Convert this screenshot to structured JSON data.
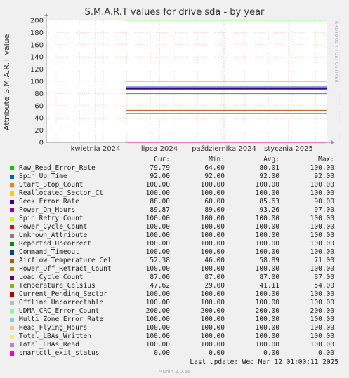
{
  "chart_data": {
    "type": "line",
    "title": "S.M.A.R.T values for drive sda - by year",
    "ylabel": "Attribute S.M.A.R.T value",
    "ylim": [
      0,
      200
    ],
    "yticks": [
      0,
      20,
      40,
      60,
      80,
      100,
      120,
      140,
      160,
      180,
      200
    ],
    "xticks": [
      "kwietnia 2024",
      "lipca 2024",
      "października 2024",
      "stycznia 2025"
    ],
    "grid": true,
    "legend_position": "bottom",
    "columns": [
      "Cur:",
      "Min:",
      "Avg:",
      "Max:"
    ],
    "series": [
      {
        "name": "Raw_Read_Error_Rate",
        "color": "#00cc00",
        "cur": "79.79",
        "min": "64.00",
        "avg": "80.01",
        "max": "100.00"
      },
      {
        "name": "Spin_Up_Time",
        "color": "#0066b3",
        "cur": "92.00",
        "min": "92.00",
        "avg": "92.00",
        "max": "92.00"
      },
      {
        "name": "Start_Stop_Count",
        "color": "#ff8000",
        "cur": "100.00",
        "min": "100.00",
        "avg": "100.00",
        "max": "100.00"
      },
      {
        "name": "Reallocated_Sector_Ct",
        "color": "#ffcc00",
        "cur": "100.00",
        "min": "100.00",
        "avg": "100.00",
        "max": "100.00"
      },
      {
        "name": "Seek_Error_Rate",
        "color": "#330099",
        "cur": "88.00",
        "min": "60.00",
        "avg": "85.63",
        "max": "90.00"
      },
      {
        "name": "Power_On_Hours",
        "color": "#990099",
        "cur": "89.87",
        "min": "89.00",
        "avg": "93.26",
        "max": "97.00"
      },
      {
        "name": "Spin_Retry_Count",
        "color": "#ccff00",
        "cur": "100.00",
        "min": "100.00",
        "avg": "100.00",
        "max": "100.00"
      },
      {
        "name": "Power_Cycle_Count",
        "color": "#ff0000",
        "cur": "100.00",
        "min": "100.00",
        "avg": "100.00",
        "max": "100.00"
      },
      {
        "name": "Unknown_Attribute",
        "color": "#808080",
        "cur": "100.00",
        "min": "100.00",
        "avg": "100.00",
        "max": "100.00"
      },
      {
        "name": "Reported_Uncorrect",
        "color": "#008f00",
        "cur": "100.00",
        "min": "100.00",
        "avg": "100.00",
        "max": "100.00"
      },
      {
        "name": "Command_Timeout",
        "color": "#00487d",
        "cur": "100.00",
        "min": "100.00",
        "avg": "100.00",
        "max": "100.00"
      },
      {
        "name": "Airflow_Temperature_Cel",
        "color": "#b35a00",
        "cur": "52.38",
        "min": "46.00",
        "avg": "58.89",
        "max": "71.00"
      },
      {
        "name": "Power_Off_Retract_Count",
        "color": "#b38f00",
        "cur": "100.00",
        "min": "100.00",
        "avg": "100.00",
        "max": "100.00"
      },
      {
        "name": "Load_Cycle_Count",
        "color": "#6b006b",
        "cur": "87.00",
        "min": "87.00",
        "avg": "87.00",
        "max": "87.00"
      },
      {
        "name": "Temperature_Celsius",
        "color": "#8fb300",
        "cur": "47.62",
        "min": "29.00",
        "avg": "41.11",
        "max": "54.00"
      },
      {
        "name": "Current_Pending_Sector",
        "color": "#b30000",
        "cur": "100.00",
        "min": "100.00",
        "avg": "100.00",
        "max": "100.00"
      },
      {
        "name": "Offline_Uncorrectable",
        "color": "#bebebe",
        "cur": "100.00",
        "min": "100.00",
        "avg": "100.00",
        "max": "100.00"
      },
      {
        "name": "UDMA_CRC_Error_Count",
        "color": "#80ff80",
        "cur": "200.00",
        "min": "200.00",
        "avg": "200.00",
        "max": "200.00"
      },
      {
        "name": "Multi_Zone_Error_Rate",
        "color": "#80c9ff",
        "cur": "100.00",
        "min": "100.00",
        "avg": "100.00",
        "max": "100.00"
      },
      {
        "name": "Head_Flying_Hours",
        "color": "#ffc080",
        "cur": "100.00",
        "min": "100.00",
        "avg": "100.00",
        "max": "100.00"
      },
      {
        "name": "Total_LBAs_Written",
        "color": "#ffe680",
        "cur": "100.00",
        "min": "100.00",
        "avg": "100.00",
        "max": "100.00"
      },
      {
        "name": "Total_LBAs_Read",
        "color": "#aa80ff",
        "cur": "100.00",
        "min": "100.00",
        "avg": "100.00",
        "max": "100.00"
      },
      {
        "name": "smartctl_exit_status",
        "color": "#ee00cc",
        "cur": "0.00",
        "min": "0.00",
        "avg": "0.00",
        "max": "0.00"
      }
    ]
  },
  "footer": {
    "last_update": "Last update: Wed Mar 12 01:00:11 2025",
    "munin": "Munin 2.0.56"
  },
  "side_label": "RRDTOOL / TOBI OETIKER"
}
